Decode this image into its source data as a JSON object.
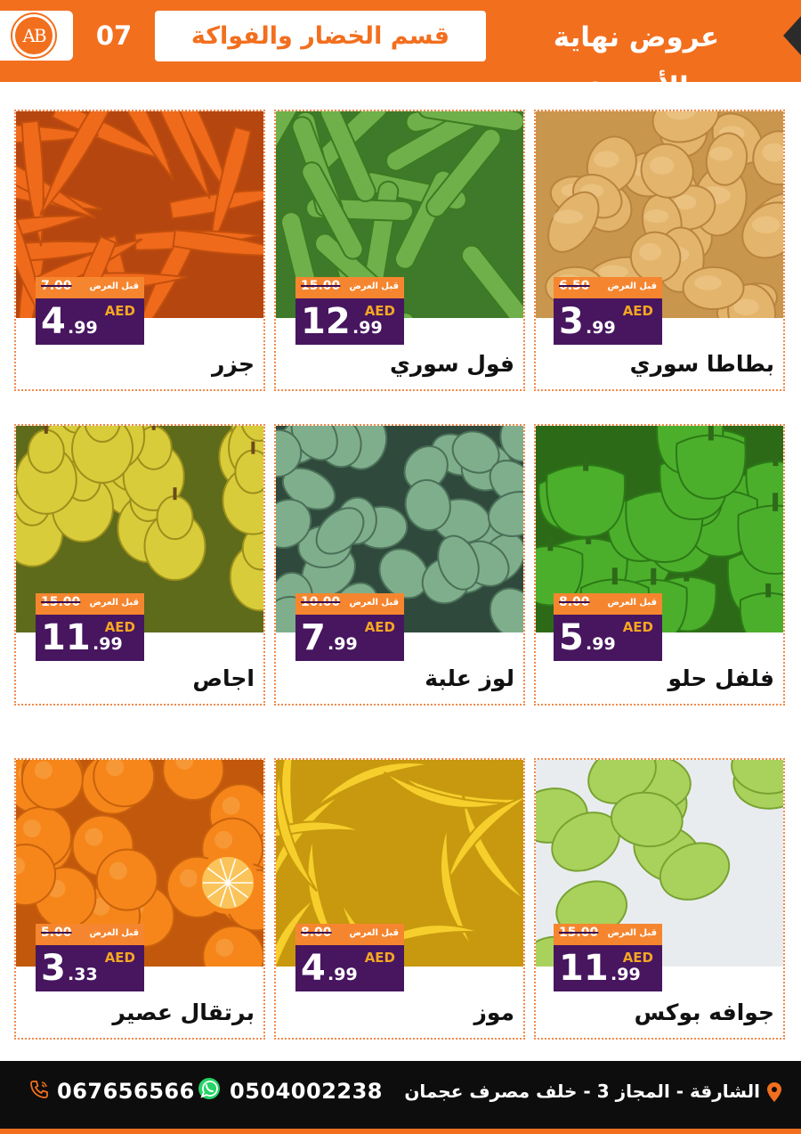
{
  "header": {
    "logo_text": "AB",
    "page_number": "07",
    "section_title": "قسم الخضار والفواكة",
    "offer_title": "عروض نهاية الأسبوع"
  },
  "colors": {
    "brand_orange": "#f26f1e",
    "badge_purple": "#47165f",
    "badge_orange": "#f5862f",
    "currency_gold": "#f5a623"
  },
  "products": [
    {
      "name": "بطاطا سوري",
      "before_label": "قبل العرض",
      "old_price": "6.50",
      "price_int": "3",
      "price_dec": ".99",
      "currency": "AED",
      "image_icon": "potatoes-photo"
    },
    {
      "name": "فول سوري",
      "before_label": "قبل العرض",
      "old_price": "15.00",
      "price_int": "12",
      "price_dec": ".99",
      "currency": "AED",
      "image_icon": "broad-beans-photo"
    },
    {
      "name": "جزر",
      "before_label": "قبل العرض",
      "old_price": "7.00",
      "price_int": "4",
      "price_dec": ".99",
      "currency": "AED",
      "image_icon": "carrots-photo"
    },
    {
      "name": "فلفل حلو",
      "before_label": "قبل العرض",
      "old_price": "8.00",
      "price_int": "5",
      "price_dec": ".99",
      "currency": "AED",
      "image_icon": "green-peppers-photo"
    },
    {
      "name": "لوز علبة",
      "before_label": "قبل العرض",
      "old_price": "10.00",
      "price_int": "7",
      "price_dec": ".99",
      "currency": "AED",
      "image_icon": "green-almonds-photo"
    },
    {
      "name": "اجاص",
      "before_label": "قبل العرض",
      "old_price": "15.00",
      "price_int": "11",
      "price_dec": ".99",
      "currency": "AED",
      "image_icon": "pears-photo"
    },
    {
      "name": "جوافه بوكس",
      "before_label": "قبل العرض",
      "old_price": "15.00",
      "price_int": "11",
      "price_dec": ".99",
      "currency": "AED",
      "image_icon": "guava-photo"
    },
    {
      "name": "موز",
      "before_label": "قبل العرض",
      "old_price": "8.00",
      "price_int": "4",
      "price_dec": ".99",
      "currency": "AED",
      "image_icon": "bananas-photo"
    },
    {
      "name": "برتقال عصير",
      "before_label": "قبل العرض",
      "old_price": "5.00",
      "price_int": "3",
      "price_dec": ".33",
      "currency": "AED",
      "image_icon": "oranges-photo"
    }
  ],
  "footer": {
    "address": "الشارقة - المجاز 3 - خلف مصرف عجمان",
    "whatsapp": "0504002238",
    "phone": "067656566",
    "icons": [
      "location-pin-icon",
      "whatsapp-icon",
      "phone-icon"
    ]
  }
}
